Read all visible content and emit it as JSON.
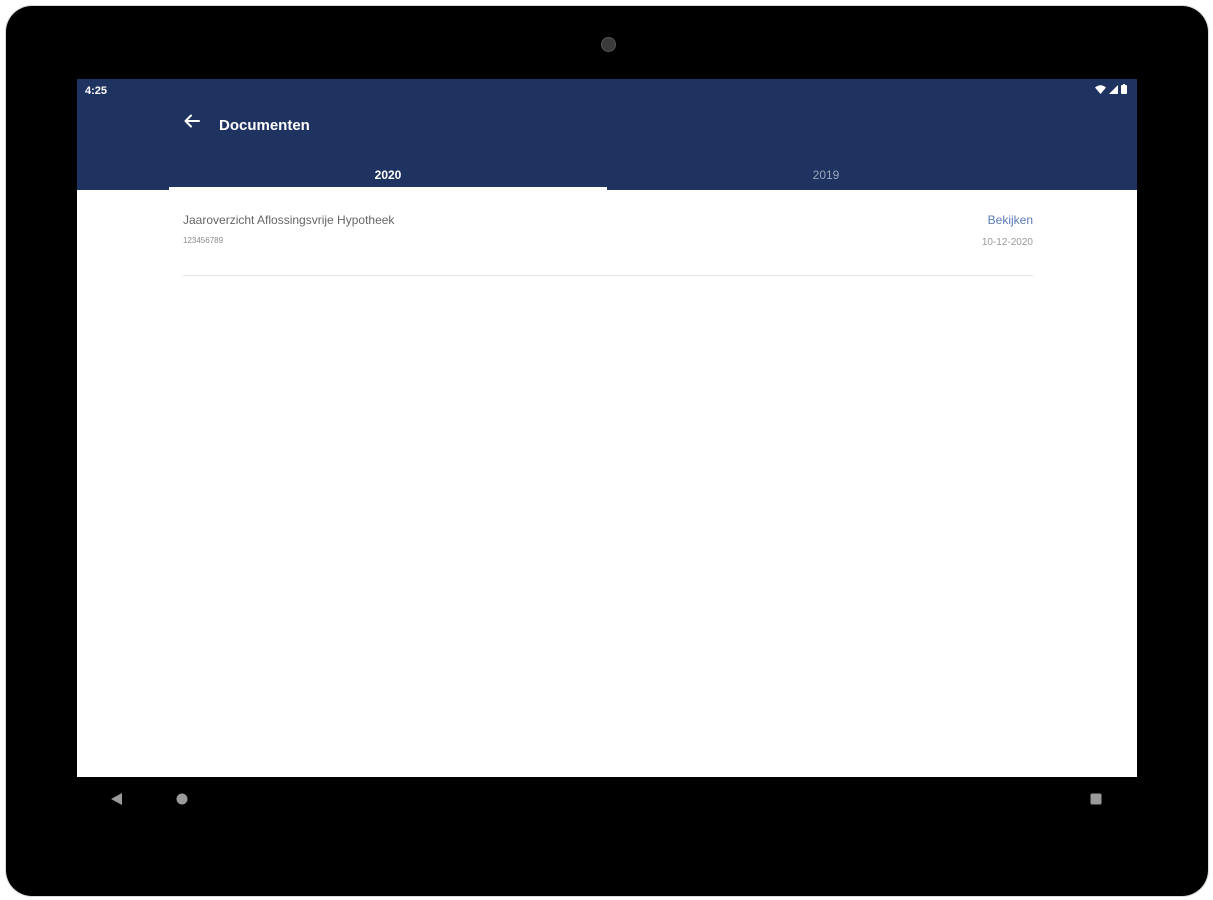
{
  "status_bar": {
    "time": "4:25"
  },
  "app_bar": {
    "title": "Documenten",
    "back_icon": "arrow-left-icon"
  },
  "tabs": [
    {
      "label": "2020",
      "active": true
    },
    {
      "label": "2019",
      "active": false
    }
  ],
  "documents": [
    {
      "title": "Jaaroverzicht Aflossingsvrije Hypotheek",
      "number": "123456789",
      "action": "Bekijken",
      "date": "10-12-2020"
    }
  ],
  "colors": {
    "app_bar": "#1f3360",
    "link": "#5b7bb5"
  }
}
